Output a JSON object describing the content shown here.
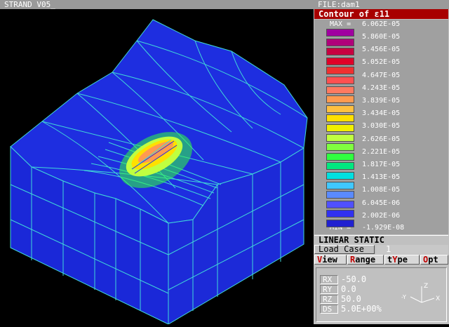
{
  "app": {
    "title": "STRAND V05_"
  },
  "file": {
    "label": "FILE:dam1"
  },
  "contour": {
    "title": "Contour of ε11"
  },
  "legend": {
    "max_label": "MAX =",
    "max_value": "6.062E-05",
    "min_label": "MIN =",
    "min_value": "-1.929E-08",
    "levels": [
      "5.860E-05",
      "5.456E-05",
      "5.052E-05",
      "4.647E-05",
      "4.243E-05",
      "3.839E-05",
      "3.434E-05",
      "3.030E-05",
      "2.626E-05",
      "2.221E-05",
      "1.817E-05",
      "1.413E-05",
      "1.008E-05",
      "6.045E-06",
      "2.002E-06"
    ],
    "colors": [
      "#a000a0",
      "#b0007a",
      "#c80040",
      "#e00028",
      "#f03030",
      "#ff5050",
      "#ff7a60",
      "#ff9a50",
      "#ffc040",
      "#ffe000",
      "#f0f000",
      "#c0ff40",
      "#80ff40",
      "#30ff40",
      "#00e880",
      "#00e0e0",
      "#40c8ff",
      "#5a8aff",
      "#5050ff",
      "#3030f0",
      "#2020d0"
    ]
  },
  "analysis": {
    "type": "LINEAR STATIC"
  },
  "load_case": {
    "label": "Load Case",
    "value": "1"
  },
  "menu": [
    {
      "hot": "V",
      "rest": "iew"
    },
    {
      "hot": "R",
      "rest": "ange"
    },
    {
      "pre": "t",
      "hot": "Y",
      "rest": "pe"
    },
    {
      "hot": "O",
      "rest": "pt"
    }
  ],
  "view": {
    "rx_label": "RX",
    "rx_value": "-50.0",
    "ry_label": "RY",
    "ry_value": "0.0",
    "rz_label": "RZ",
    "rz_value": "50.0",
    "ds_label": "DS",
    "ds_value": "5.0E+00%"
  },
  "triad": {
    "z": "Z",
    "y": "-Y",
    "x": "X"
  },
  "model_colors": {
    "fill": "#1e2ee0",
    "mesh": "#40d8d8",
    "hot": "#ffe000"
  }
}
